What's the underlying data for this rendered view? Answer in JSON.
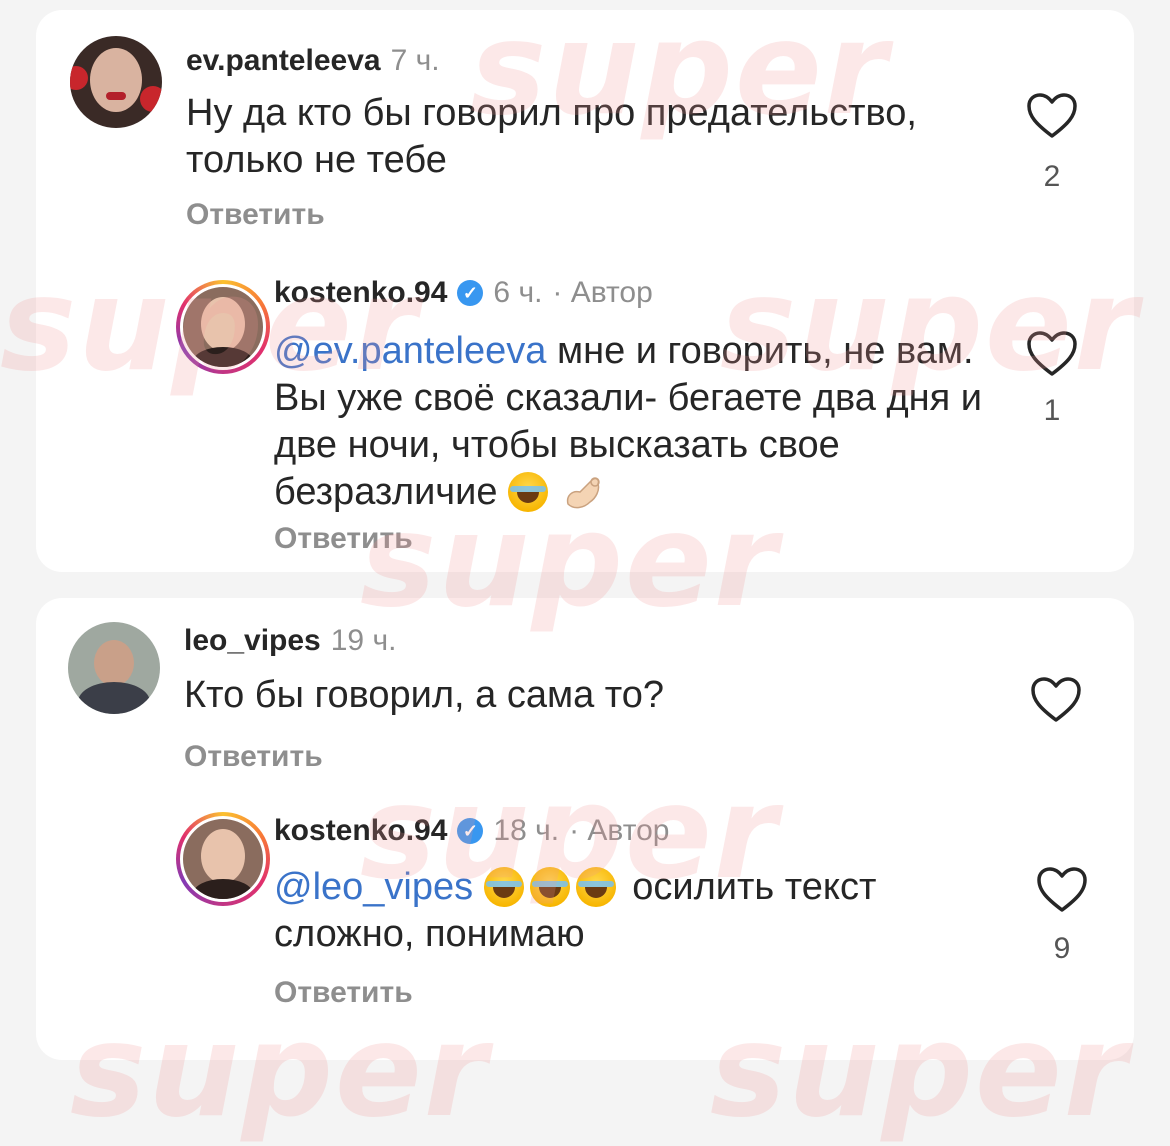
{
  "comments": [
    {
      "username": "ev.panteleeva",
      "time": "7 ч.",
      "text": "Ну да кто бы говорил про предательство, только не тебе",
      "reply_label": "Ответить",
      "likes": "2",
      "reply": {
        "username": "kostenko.94",
        "time": "6 ч.",
        "author_label": "· Автор",
        "mention": "@ev.panteleeva",
        "text": "мне и говорить, не вам. Вы уже своё сказали- бегаете два дня и две ночи, чтобы высказать свое безразличие",
        "emojis": [
          "face-with-tears-of-joy-icon",
          "pinching-hand-icon"
        ],
        "reply_label": "Ответить",
        "likes": "1"
      }
    },
    {
      "username": "leo_vipes",
      "time": "19 ч.",
      "text": "Кто бы говорил, а сама то?",
      "reply_label": "Ответить",
      "likes": "",
      "reply": {
        "username": "kostenko.94",
        "time": "18 ч.",
        "author_label": "· Автор",
        "mention": "@leo_vipes",
        "text": "осилить текст сложно, понимаю",
        "emojis": [
          "face-with-tears-of-joy-icon",
          "face-with-tears-of-joy-icon",
          "face-with-tears-of-joy-icon"
        ],
        "reply_label": "Ответить",
        "likes": "9"
      }
    }
  ],
  "watermark": "super",
  "colors": {
    "mention": "#3a73c9",
    "verified": "#3897f0",
    "muted": "#8e8e8e",
    "watermark": "#f09696"
  }
}
